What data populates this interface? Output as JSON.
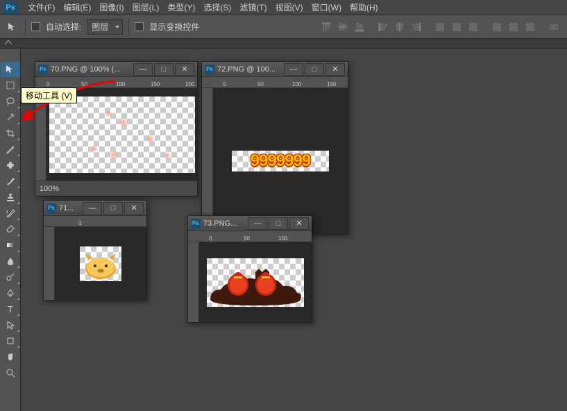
{
  "app": {
    "logo": "Ps"
  },
  "menu": [
    "文件(F)",
    "编辑(E)",
    "图像(I)",
    "图层(L)",
    "类型(Y)",
    "选择(S)",
    "滤镜(T)",
    "视图(V)",
    "窗口(W)",
    "帮助(H)"
  ],
  "optbar": {
    "auto_select": "自动选择:",
    "layer_dd": "图层",
    "show_transform": "显示变换控件"
  },
  "tooltip": "移动工具 (V)",
  "tools": [
    "move",
    "marquee",
    "lasso",
    "wand",
    "crop",
    "eyedrop",
    "heal",
    "brush",
    "stamp",
    "history",
    "eraser",
    "gradient",
    "blur",
    "dodge",
    "pen",
    "type",
    "path",
    "shape",
    "hand",
    "zoom"
  ],
  "docs": {
    "d70": {
      "title": "70.PNG @ 100% (...",
      "zoom": "100%",
      "ruler": [
        "0",
        "50",
        "100",
        "150",
        "200"
      ]
    },
    "d71": {
      "title": "71...",
      "ruler": [
        "0"
      ]
    },
    "d72": {
      "title": "72.PNG @ 100...",
      "ruler": [
        "0",
        "50",
        "100",
        "150"
      ],
      "content": "9999999"
    },
    "d73": {
      "title": "73.PNG...",
      "ruler": [
        "0",
        "50",
        "100"
      ]
    }
  }
}
